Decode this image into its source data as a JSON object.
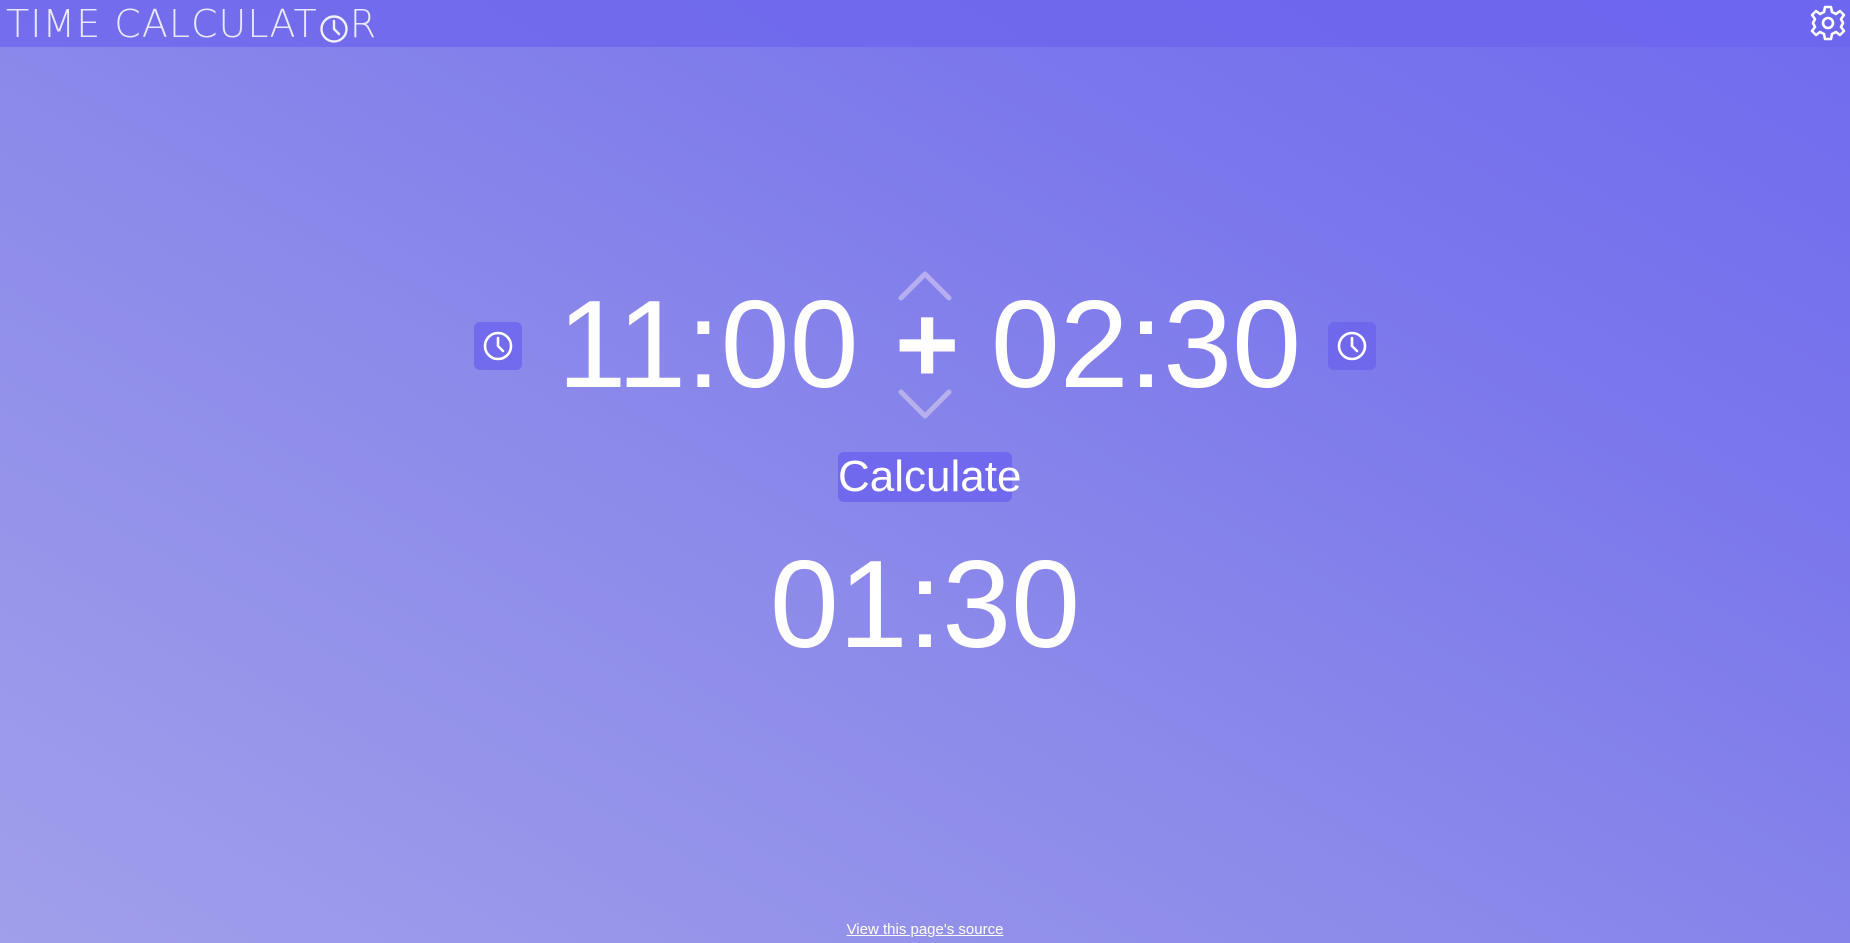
{
  "header": {
    "logo_prefix": "TIME CALCUL",
    "logo_middle": "AT",
    "logo_suffix": "R",
    "logo_icon": "clock-icon",
    "settings_icon": "gear-icon"
  },
  "calculator": {
    "left_time": "11:00",
    "right_time": "02:30",
    "operator": "+",
    "left_picker_icon": "clock-icon",
    "right_picker_icon": "clock-icon",
    "up_icon": "chevron-up-icon",
    "down_icon": "chevron-down-icon",
    "calculate_label": "Calculate",
    "result": "01:30"
  },
  "footer": {
    "source_link": "View this page's source"
  },
  "colors": {
    "accent": "#6c64ee",
    "text": "#ffffff"
  }
}
